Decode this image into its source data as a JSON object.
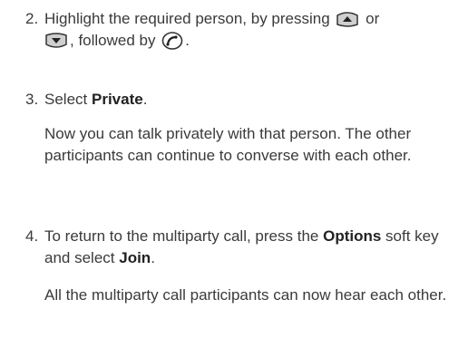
{
  "steps": [
    {
      "num": "2.",
      "line1_a": "Highlight the required person, by pressing",
      "line1_b": "or",
      "line2_a": ", followed by",
      "line2_b": "."
    },
    {
      "num": "3.",
      "pre": "Select",
      "bold": "Private",
      "post": ".",
      "note": "Now you can talk privately with that person. The other participants can continue to converse with each other."
    },
    {
      "num": "4.",
      "a": "To return to the multiparty call, press the",
      "bold1": "Options",
      "b": "soft key and select",
      "bold2": "Join",
      "c": ".",
      "note": "All the multiparty call participants can now hear each other."
    }
  ],
  "icons": [
    "scroll-up-key-icon",
    "scroll-down-key-icon",
    "call-key-icon"
  ]
}
